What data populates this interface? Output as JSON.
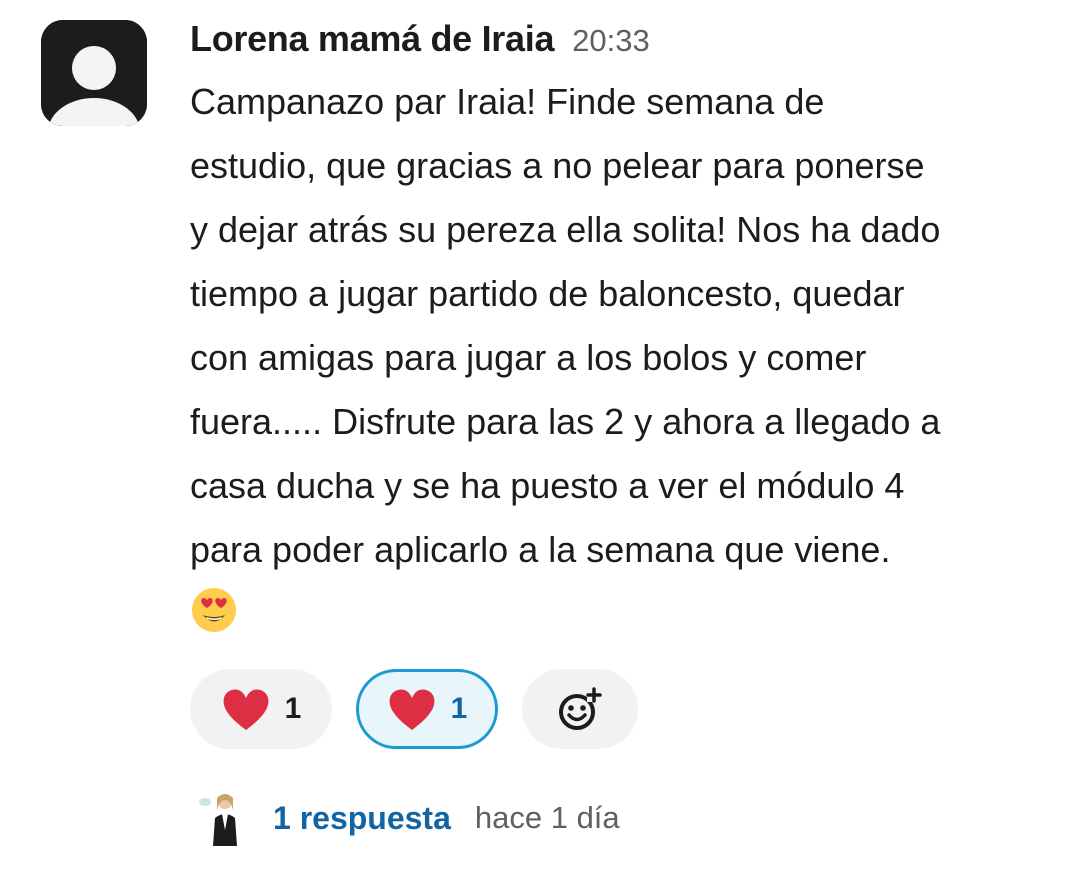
{
  "message": {
    "author": "Lorena mamá de Iraia",
    "time": "20:33",
    "text": "Campanazo par Iraia! Finde semana de\nestudio, que gracias a no pelear para ponerse\ny dejar atrás su pereza ella solita! Nos ha dado\ntiempo a jugar partido de baloncesto, quedar\ncon amigas para jugar a los bolos y comer\nfuera..... Disfrute para las 2 y ahora a llegado a\ncasa ducha y se ha puesto a ver el módulo 4\npara poder aplicarlo a la semana que viene.",
    "trailing_emoji": "smiling-face-with-heart-eyes"
  },
  "reactions": [
    {
      "emoji": "red-heart",
      "count": "1",
      "selected": false
    },
    {
      "emoji": "red-heart",
      "count": "1",
      "selected": true
    }
  ],
  "add_reaction_icon": "add-reaction-icon",
  "thread": {
    "replies_label": "1 respuesta",
    "last_reply": "hace 1 día"
  },
  "colors": {
    "link": "#1264a3",
    "selected_border": "#1d9bd1",
    "selected_bg": "#e8f5fa",
    "pill_bg": "#f2f2f2",
    "muted": "#616061",
    "heart": "#dd2e44"
  }
}
